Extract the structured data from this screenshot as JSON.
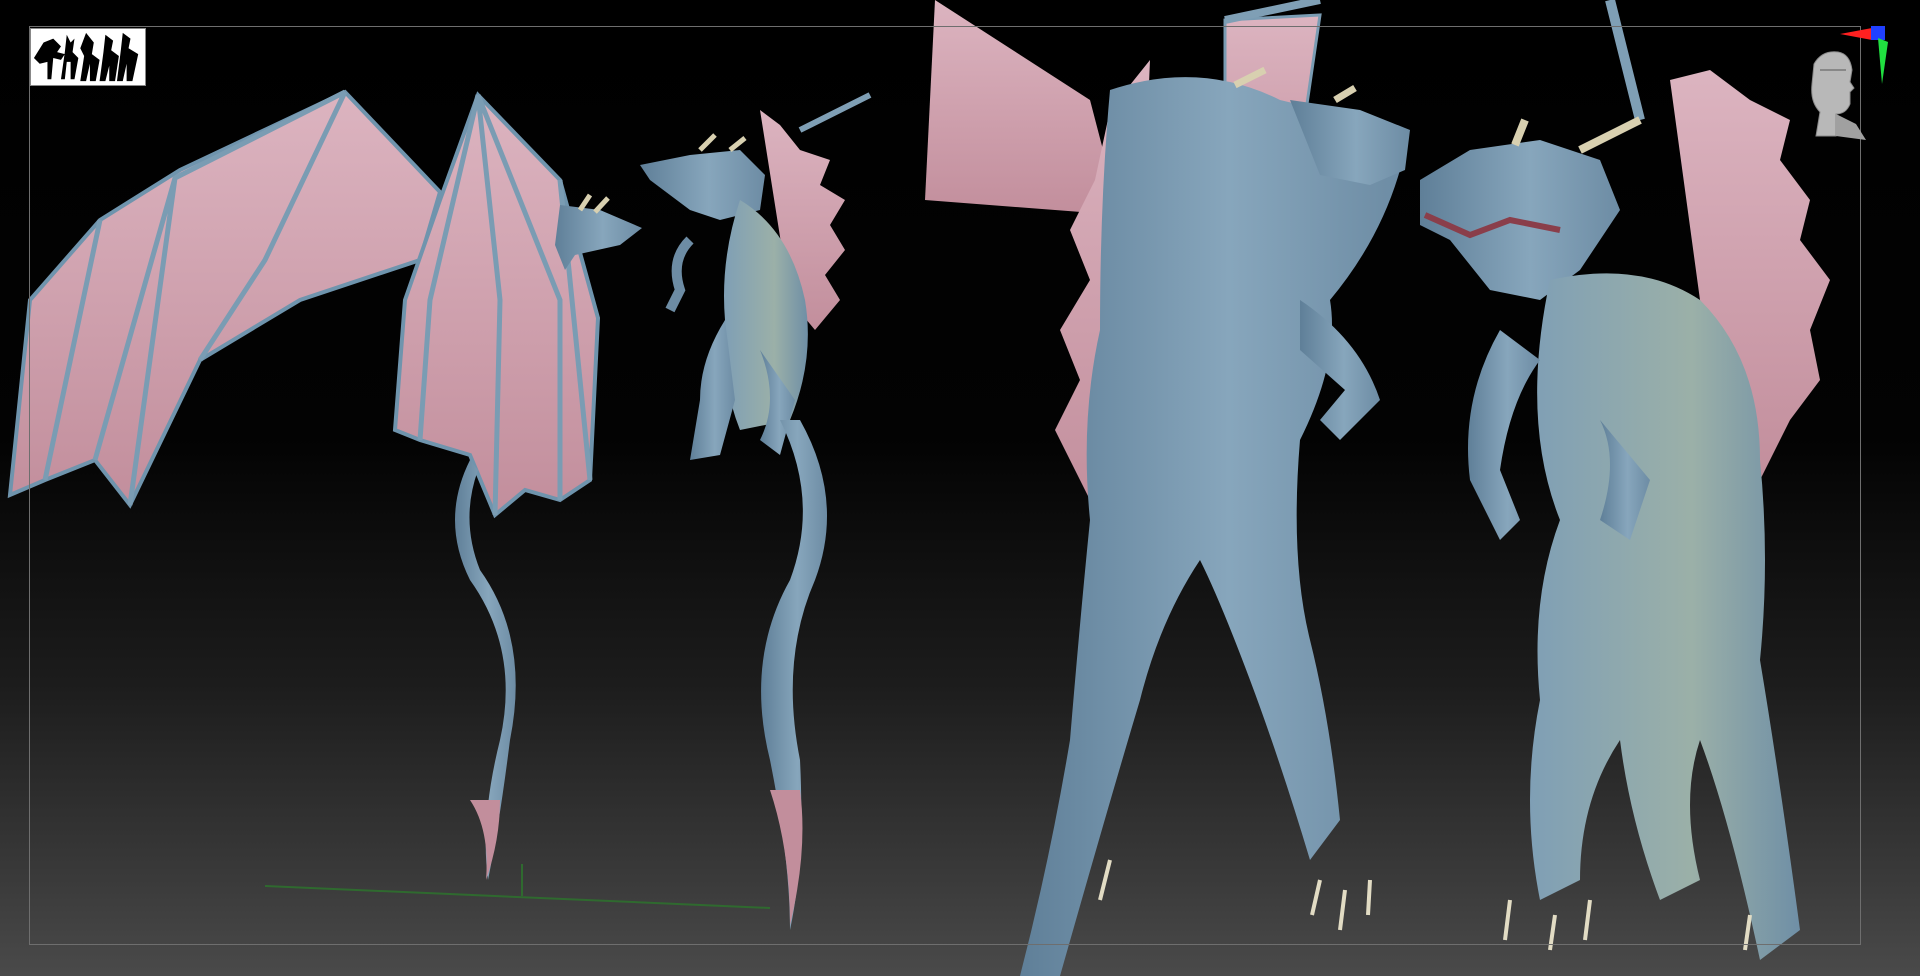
{
  "app": {
    "title": ""
  },
  "colors": {
    "bg_top": "#000000",
    "bg_bottom": "#4a4a4a",
    "frame": "#6e6e6e",
    "skin": "#7f9fb5",
    "skin_dark": "#5f7f98",
    "membrane": "#d3a7b3",
    "membrane_dark": "#b98a98",
    "horn": "#d8d0b0",
    "gizmo_red": "#ff2020",
    "gizmo_green": "#20e040",
    "gizmo_blue": "#2040ff",
    "ground_line": "#2f6a2f"
  },
  "icons": {
    "thumbnail": "subtool-thumbnail-icon",
    "navigation": "navigation-head-icon",
    "axis": "axis-gizmo-icon"
  }
}
